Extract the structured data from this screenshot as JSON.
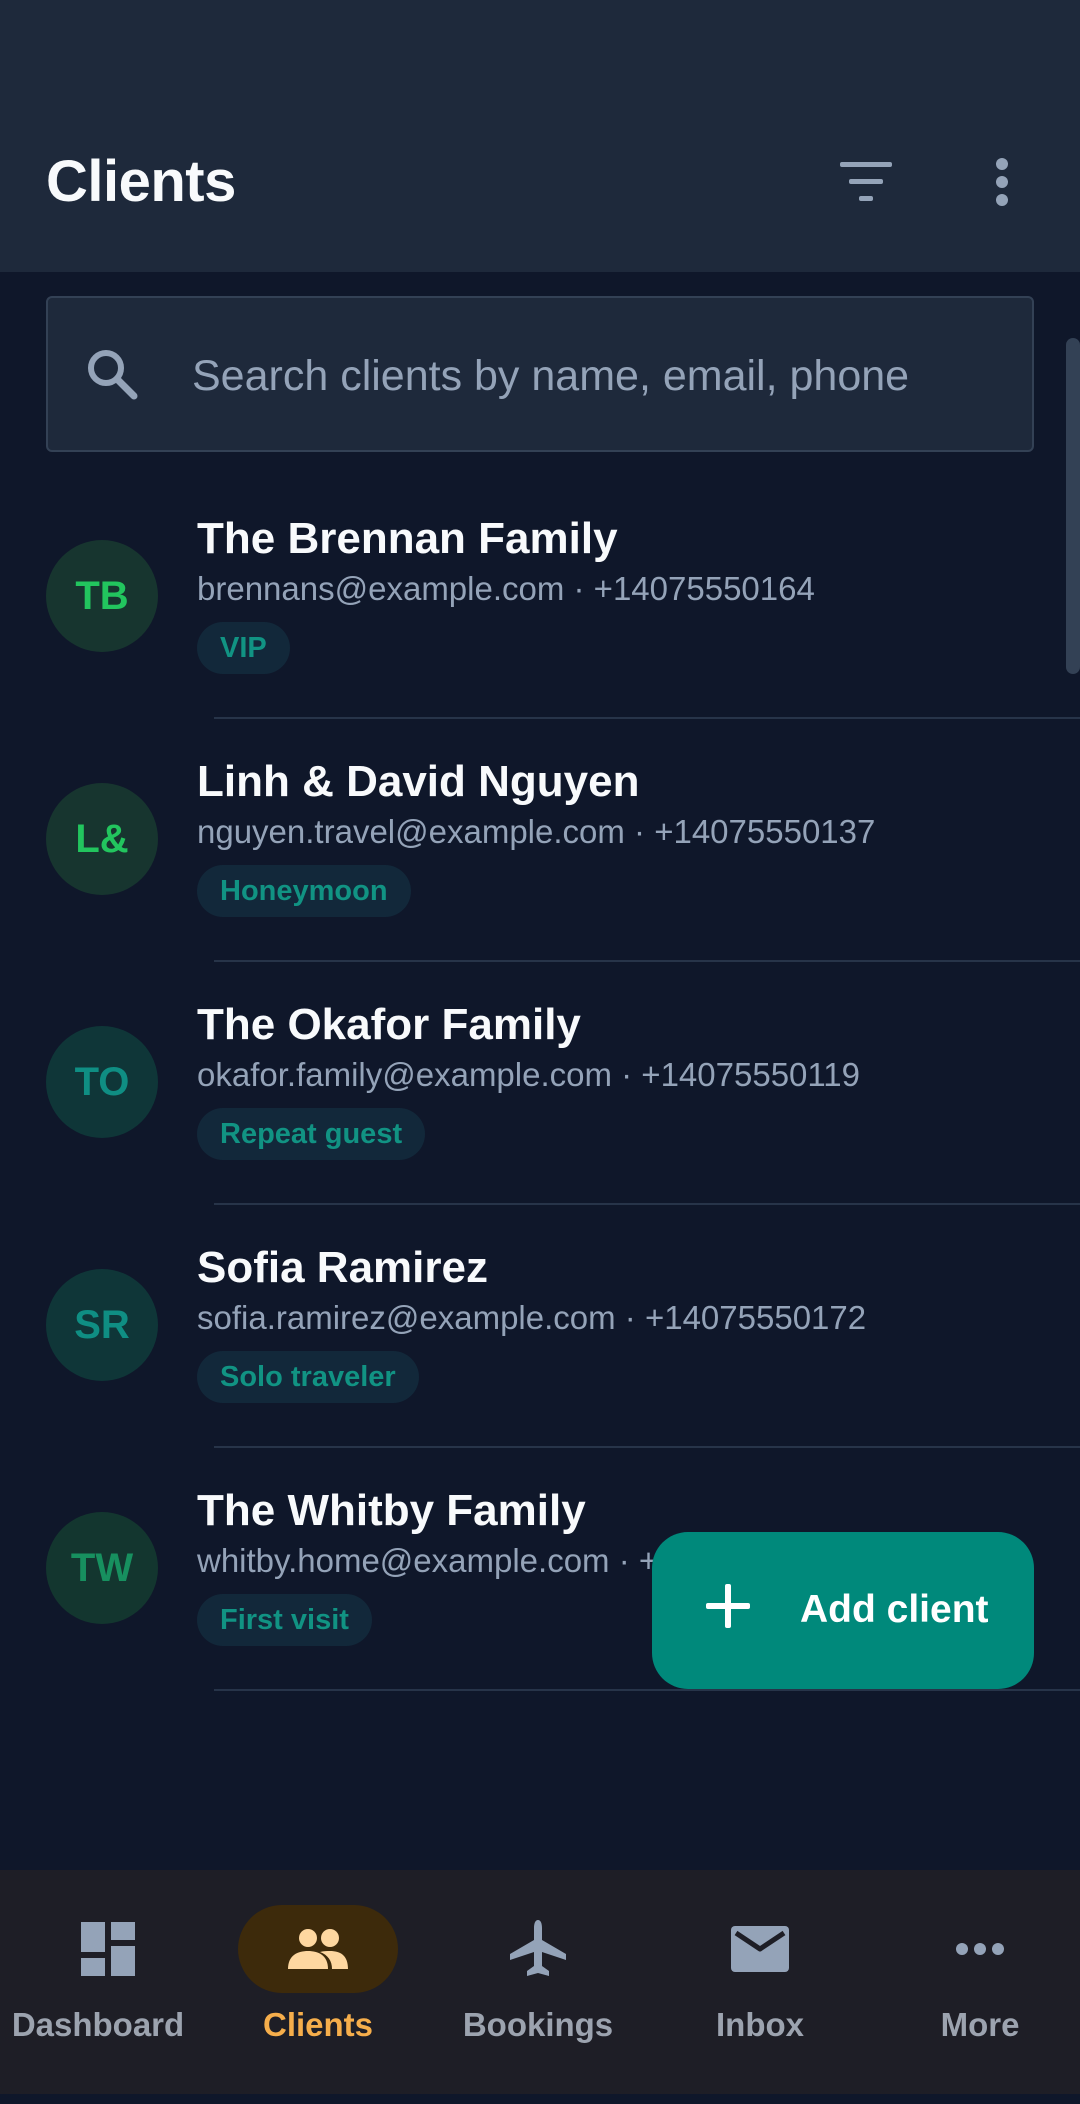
{
  "header": {
    "title": "Clients",
    "filter_icon": "filter-icon",
    "more_icon": "more-vertical-icon"
  },
  "search": {
    "placeholder": "Search clients by name, email, phone",
    "value": "",
    "icon": "search-icon"
  },
  "clients": [
    {
      "initials": "TB",
      "name": "The Brennan Family",
      "meta": "brennans@example.com · +14075550164",
      "tag": "VIP",
      "avatar_bg": "#17352f",
      "avatar_fg": "#22c55e"
    },
    {
      "initials": "L&",
      "name": "Linh & David Nguyen",
      "meta": "nguyen.travel@example.com · +14075550137",
      "tag": "Honeymoon",
      "avatar_bg": "#17352f",
      "avatar_fg": "#22c55e"
    },
    {
      "initials": "TO",
      "name": "The Okafor Family",
      "meta": "okafor.family@example.com · +14075550119",
      "tag": "Repeat guest",
      "avatar_bg": "#0f3638",
      "avatar_fg": "#0f8e83"
    },
    {
      "initials": "SR",
      "name": "Sofia Ramirez",
      "meta": "sofia.ramirez@example.com · +14075550172",
      "tag": "Solo traveler",
      "avatar_bg": "#0f3638",
      "avatar_fg": "#0f8e83"
    },
    {
      "initials": "TW",
      "name": "The Whitby Family",
      "meta": "whitby.home@example.com · +14075550",
      "tag": "First visit",
      "avatar_bg": "#13362f",
      "avatar_fg": "#17905f"
    }
  ],
  "fab": {
    "label": "Add client",
    "icon": "plus-icon"
  },
  "bottom_nav": [
    {
      "label": "Dashboard",
      "icon": "dashboard-icon",
      "active": false
    },
    {
      "label": "Clients",
      "icon": "people-icon",
      "active": true
    },
    {
      "label": "Bookings",
      "icon": "airplane-icon",
      "active": false
    },
    {
      "label": "Inbox",
      "icon": "mail-icon",
      "active": false
    },
    {
      "label": "More",
      "icon": "more-horizontal-icon",
      "active": false
    }
  ],
  "colors": {
    "background": "#0f172a",
    "surface": "#1e293b",
    "accent": "#00897b",
    "nav_active": "#f6ae4b",
    "nav_active_pill": "#3d2a0b",
    "tag_text": "#119383"
  }
}
